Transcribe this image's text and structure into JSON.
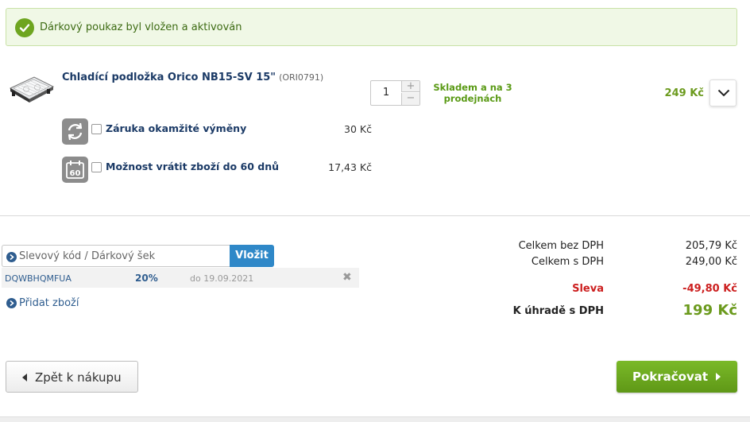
{
  "alert": {
    "message": "Dárkový poukaz byl vložen a aktivován",
    "icon": "check-circle-icon",
    "color": "#6ea520"
  },
  "product": {
    "name": "Chladící podložka Orico NB15-SV 15\"",
    "code": "(ORI0791)",
    "quantity": "1",
    "stock": "Skladem a na 3 prodejnách",
    "price": "249 Kč",
    "image": "laptop-cooling-pad"
  },
  "services": [
    {
      "label": "Záruka okamžité výměny",
      "price": "30 Kč",
      "icon": "exchange-arrows-icon",
      "checked": false
    },
    {
      "label": "Možnost vrátit zboží do 60 dnů",
      "price": "17,43 Kč",
      "icon": "calendar-60-icon",
      "checked": false
    }
  ],
  "coupon": {
    "placeholder": "Slevový kód / Dárkový šek",
    "button": "Vložit",
    "applied": {
      "code": "DQWBHQMFUA",
      "discount": "20%",
      "valid_until": "do 19.09.2021"
    }
  },
  "add_item": "Přidat zboží",
  "summary": {
    "without_vat_label": "Celkem bez DPH",
    "without_vat": "205,79 Kč",
    "with_vat_label": "Celkem s DPH",
    "with_vat": "249,00 Kč",
    "discount_label": "Sleva",
    "discount": "-49,80 Kč",
    "total_label": "K úhradě s DPH",
    "total": "199 Kč"
  },
  "buttons": {
    "back": "Zpět k nákupu",
    "continue": "Pokračovat"
  },
  "colors": {
    "accent_green": "#6ea520",
    "link_blue": "#2f5d8f",
    "button_blue": "#2f88c8",
    "discount_red": "#cc1f1f",
    "total_green": "#6b9a1d"
  }
}
